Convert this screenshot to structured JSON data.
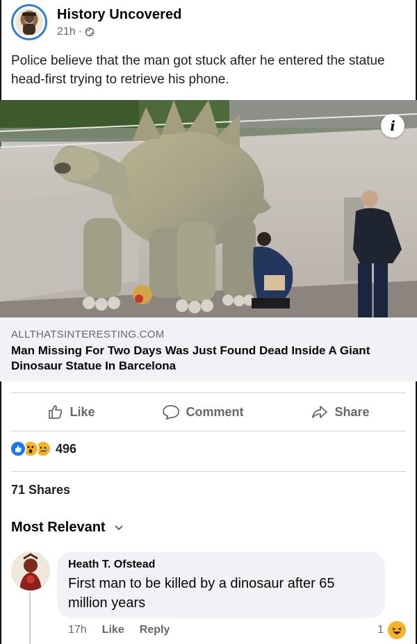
{
  "post": {
    "page_name": "History Uncovered",
    "time": "21h",
    "time_separator": "·",
    "caption": "Police believe that the man got stuck after he entered the statue head-first trying to retrieve his phone."
  },
  "photo": {
    "info_glyph": "i"
  },
  "link": {
    "domain": "ALLTHATSINTERESTING.COM",
    "title": "Man Missing For Two Days Was Just Found Dead Inside A Giant Dinosaur Statue In Barcelona"
  },
  "actions": {
    "like": "Like",
    "comment": "Comment",
    "share": "Share"
  },
  "reactions": {
    "count": "496",
    "types": [
      "like",
      "wow",
      "sad"
    ]
  },
  "shares": "71 Shares",
  "comments_sort": "Most Relevant",
  "comment": {
    "author": "Heath T. Ofstead",
    "text": "First man to be killed by a dinosaur after 65 million years",
    "time": "17h",
    "like": "Like",
    "reply": "Reply",
    "reaction_count": "1",
    "reaction_type": "haha"
  },
  "colors": {
    "facebook_blue": "#1877f2",
    "secondary_text": "#65676b",
    "preview_bg": "#f0f2f5",
    "reaction_yellow": "#f7b125"
  }
}
